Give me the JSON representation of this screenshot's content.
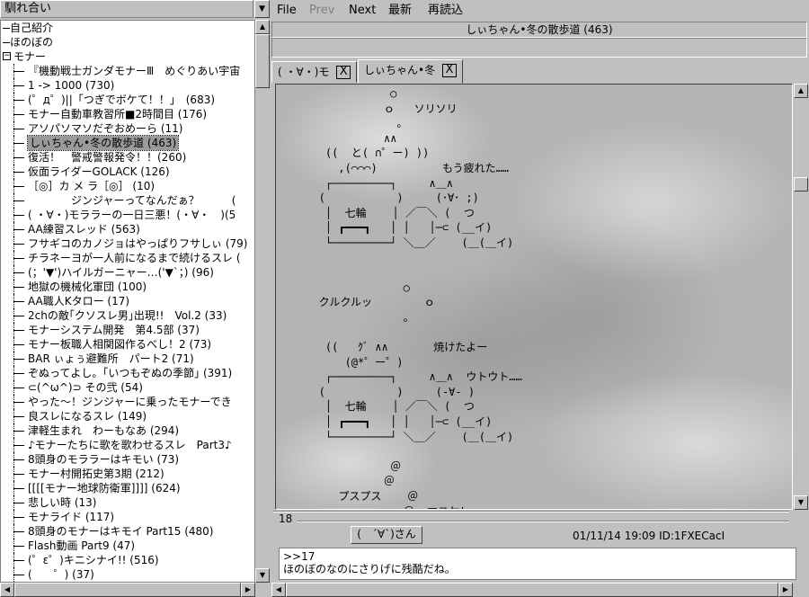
{
  "board": {
    "title": "馴れ合い",
    "dropdown_arrow": "▼"
  },
  "tree": {
    "top_items": [
      "自己紹介",
      "ほのぼの"
    ],
    "expanded_group": "モナー",
    "expander_symbol": "−",
    "threads": [
      "『機動戦士ガンダモナーⅢ　めぐりあい宇宙",
      "1 -> 1000 (730)",
      "(゜д゜)||「つぎでボケて！！」　(683)",
      "モナー自動車教習所■2時間目 (176)",
      "アソパソマソだぞおめーら (11)",
      "しぃちゃん•冬の散歩道 (463)",
      "復活！　警戒警報発令！！(260)",
      "仮面ライダーGOLACK (126)",
      "［◎］カ メ ラ［◎］ (10)",
      "　　　　ジンジャーってなんだぁ？　　　(",
      "( ・∀・)モララーの一日三悪！(・∀・　)(5",
      "AA練習スレッド (563)",
      "フサギコのカノジョはやっぱりフサしぃ (79)",
      "チラネーヨが一人前になるまで続けるスレ (",
      "(；'▼')ハイルガーニャー…('▼`；) (96)",
      "地獄の機械化軍団 (100)",
      "AA職人Kタロー (17)",
      "2chの敵｢クソスレ男｣出現!!　Vol.2 (33)",
      "モナーシステム開発　第4.5部 (37)",
      "モナー板職人相関図作るべし！2 (73)",
      "BAR ぃょぅ避難所　パート2 (71)",
      "ぞぬってよし。｢いつもぞぬの季節｣ (391)",
      "⊂(^ω^)⊃ その弐 (54)",
      "やった～！ジンジャーに乗ったモナーでき",
      "良スレになるスレ (149)",
      "津軽生まれ　わーもなあ (294)",
      "♪モナーたちに歌を歌わせるスレ　Part3♪",
      "8頭身のモララーはキモい (73)",
      "モナー村開拓史第3期 (212)",
      "[[[[モナー地球防衛軍]]]] (624)",
      "悲しい時 (13)",
      "モナライド (117)",
      "8頭身のモナーはキモイ Part15 (480)",
      "Flash動画 Part9 (47)",
      "(゜ε゜)キニシナイ!! (516)",
      "(　　゜) (37)"
    ],
    "selected_index": 5
  },
  "menu": {
    "file": "File",
    "prev": "Prev",
    "next": "Next",
    "latest": "最新",
    "reload": "再読込"
  },
  "thread": {
    "title": "しぃちゃん•冬の散歩道 (463)",
    "address": ""
  },
  "tabs": [
    {
      "label": "( ・∀・)モ",
      "close": "X"
    },
    {
      "label": "しぃちゃん•冬",
      "close": "X"
    }
  ],
  "post": {
    "aa": "              ○\n             ｏ   ソリソリ\n               。\n             ∧∧\n    ((  と( ∩゜ー) ))\n      ,(⌒⌒⌒)          もう疲れた……\n    ┌─────────┐     ∧＿∧\n   (           )     (･∀･ ;)\n    │  七輪    │ ／￣＼ (  つ\n    │ ┏━━━┓   │ │   │─⊂ (__イ)\n    └─────────┘ ＼＿／    (＿(＿イ)\n\n\n                ○\n   クルクルッ        ｏ\n                。\n\n    ((   ｸﾞ ∧∧       焼けたよー\n       (@*゜ー゜)\n    ┌─────────┐     ∧＿∧  ウトウト……\n   (           )     (-∀- )\n    │  七輪    │ ／￣＼ (  つ\n    │ ┏━━━┓   │ │   │─⊂ (__イ)\n    └─────────┘ ＼＿／    (＿(＿イ)\n\n              ＠\n             ＠\n      プスプス    ＠\n                ＠  マヌケ!\n      ,,,,,,,,,,,,*゜ー゜)           ハッ!\n    ┌─────────┐     ∧＿∧    しまった\n   (           )     (T∀T )\n    │  七輪    │ ／￣＼ (  つ\n    │ ┏━━━┓   │ │   │─⊂ (__イ)\n    └─────────┘ ＼＿／    (＿(＿イ)",
    "number": "18",
    "name": "(　´∀`)さん",
    "date": "01/11/14 19:09 ID:1FXECacI",
    "body_line1": ">>17",
    "body_line2": "ほのぼのなのにさりげに残酷だね。"
  },
  "scroll_arrows": {
    "up": "▲",
    "down": "▼",
    "left": "◀",
    "right": "▶"
  }
}
